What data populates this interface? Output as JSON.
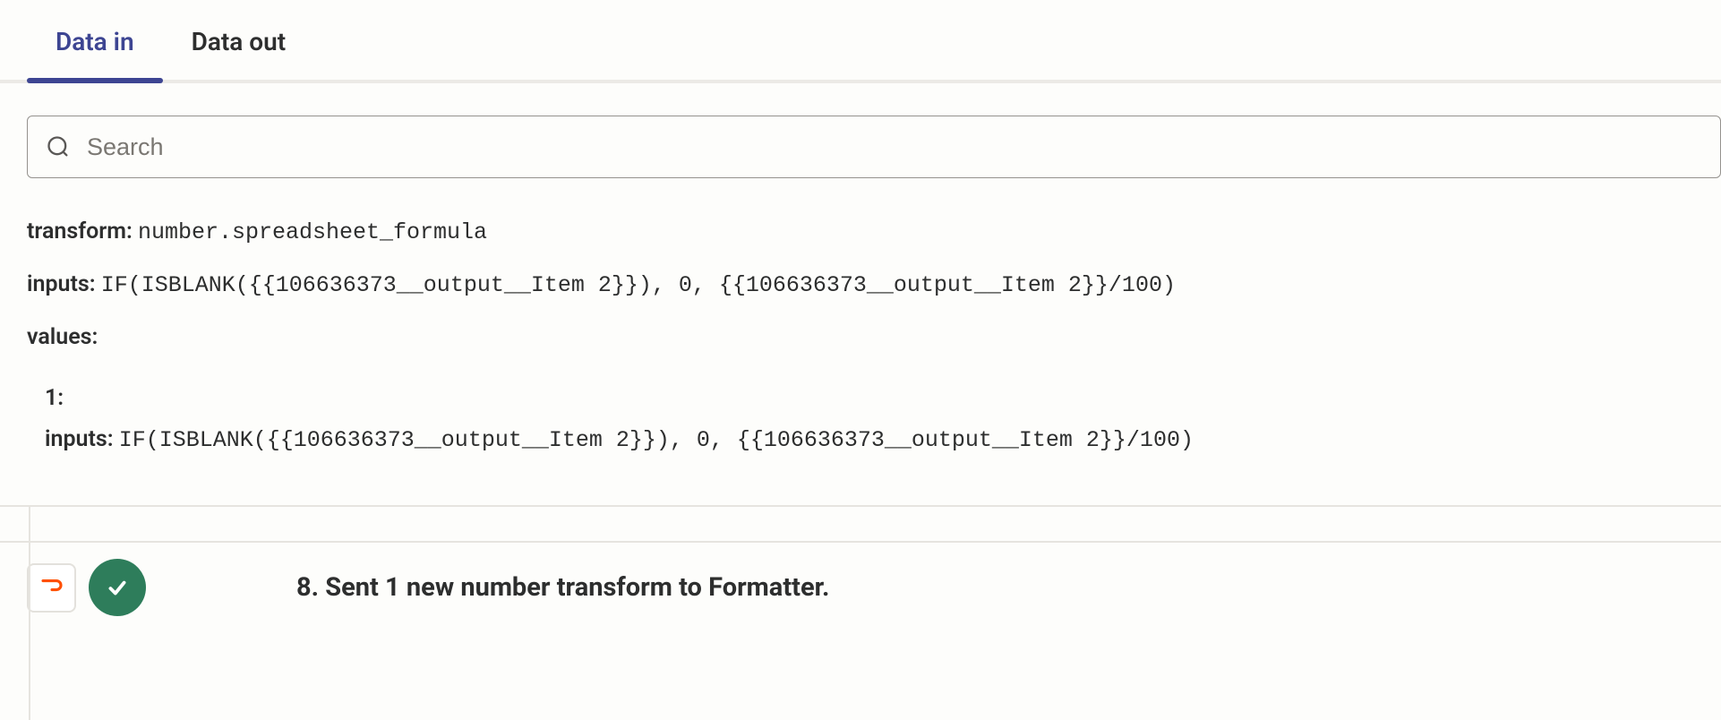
{
  "tabs": {
    "data_in": "Data in",
    "data_out": "Data out"
  },
  "search": {
    "placeholder": "Search"
  },
  "fields": {
    "transform_label": "transform:",
    "transform_value": "number.spreadsheet_formula",
    "inputs_label": "inputs:",
    "inputs_value": "IF(ISBLANK({{106636373__output__Item 2}}), 0, {{106636373__output__Item 2}}/100)",
    "values_label": "values:",
    "values_item_index": "1:",
    "values_item_inputs_label": "inputs:",
    "values_item_inputs_value": "IF(ISBLANK({{106636373__output__Item 2}}), 0, {{106636373__output__Item 2}}/100)"
  },
  "step": {
    "title": "8. Sent 1 new number transform to Formatter."
  }
}
